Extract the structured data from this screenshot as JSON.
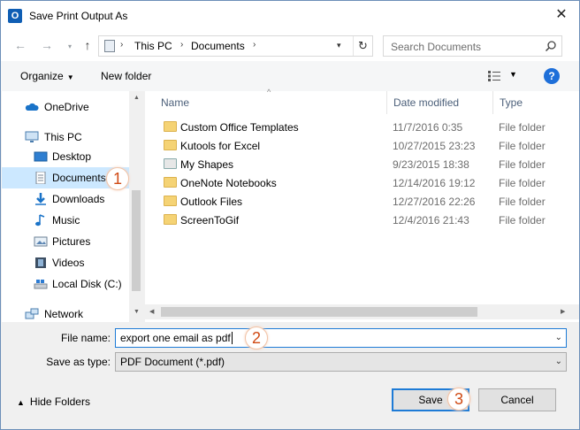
{
  "window": {
    "title": "Save Print Output As",
    "app_icon_letter": "O"
  },
  "address": {
    "crumbs": [
      "This PC",
      "Documents"
    ],
    "search_placeholder": "Search Documents"
  },
  "toolbar": {
    "organize_label": "Organize",
    "new_folder_label": "New folder"
  },
  "nav": {
    "items": [
      {
        "label": "OneDrive",
        "icon": "cloud-icon"
      },
      {
        "label": "This PC",
        "icon": "computer-icon"
      },
      {
        "label": "Desktop",
        "icon": "desktop-icon"
      },
      {
        "label": "Documents",
        "icon": "documents-icon",
        "selected": true
      },
      {
        "label": "Downloads",
        "icon": "download-arrow-icon"
      },
      {
        "label": "Music",
        "icon": "music-note-icon"
      },
      {
        "label": "Pictures",
        "icon": "pictures-icon"
      },
      {
        "label": "Videos",
        "icon": "film-icon"
      },
      {
        "label": "Local Disk (C:)",
        "icon": "disk-icon"
      },
      {
        "label": "Network",
        "icon": "network-icon"
      }
    ]
  },
  "files": {
    "columns": {
      "name": "Name",
      "date": "Date modified",
      "type": "Type"
    },
    "rows": [
      {
        "name": "Custom Office Templates",
        "date": "11/7/2016 0:35",
        "type": "File folder"
      },
      {
        "name": "Kutools for Excel",
        "date": "10/27/2015 23:23",
        "type": "File folder"
      },
      {
        "name": "My Shapes",
        "date": "9/23/2015 18:38",
        "type": "File folder"
      },
      {
        "name": "OneNote Notebooks",
        "date": "12/14/2016 19:12",
        "type": "File folder"
      },
      {
        "name": "Outlook Files",
        "date": "12/27/2016 22:26",
        "type": "File folder"
      },
      {
        "name": "ScreenToGif",
        "date": "12/4/2016 21:43",
        "type": "File folder"
      }
    ]
  },
  "form": {
    "file_name_label": "File name:",
    "file_name_value": "export one email as pdf",
    "save_type_label": "Save as type:",
    "save_type_value": "PDF Document (*.pdf)"
  },
  "footer": {
    "hide_folders_label": "Hide Folders",
    "save_label": "Save",
    "cancel_label": "Cancel"
  },
  "callouts": {
    "one": "1",
    "two": "2",
    "three": "3"
  },
  "colors": {
    "accent": "#1e7bd6",
    "selection": "#cce8ff",
    "callout": "#d04a14"
  }
}
